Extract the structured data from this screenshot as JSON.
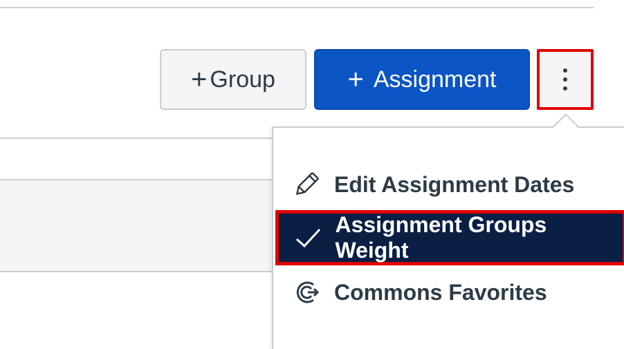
{
  "toolbar": {
    "group_button_label": "Group",
    "assignment_button_label": "Assignment",
    "plus_symbol": "+",
    "kebab_icon": "kebab-vertical-icon"
  },
  "menu": {
    "items": [
      {
        "label": "Edit Assignment Dates",
        "icon": "pencil-icon"
      },
      {
        "label": "Assignment Groups Weight",
        "icon": "checkmark-icon",
        "selected": true
      },
      {
        "label": "Commons Favorites",
        "icon": "commons-share-icon"
      }
    ]
  },
  "colors": {
    "primary_button": "#0b55c4",
    "selected_item_bg": "#0a1f44",
    "highlight_border": "#e00000",
    "text": "#2d3b45"
  }
}
